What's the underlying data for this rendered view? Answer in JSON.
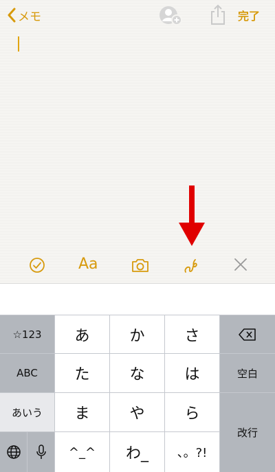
{
  "nav": {
    "back_label": "メモ",
    "done_label": "完了"
  },
  "toolbar": {
    "aa_label": "Aa"
  },
  "keyboard": {
    "row1": {
      "left": "☆123",
      "keys": [
        "あ",
        "か",
        "さ"
      ]
    },
    "row2": {
      "left": "ABC",
      "keys": [
        "た",
        "な",
        "は"
      ],
      "right": "空白"
    },
    "row3": {
      "left": "あいう",
      "keys": [
        "ま",
        "や",
        "ら"
      ]
    },
    "row4": {
      "keys": [
        "^_^",
        "わ_",
        "、。?!"
      ]
    },
    "return_label": "改行"
  },
  "colors": {
    "accent": "#d79a0c",
    "annotation": "#e00000"
  },
  "icons": [
    "chevron-left-icon",
    "add-person-icon",
    "share-icon",
    "checklist-icon",
    "camera-icon",
    "sketch-icon",
    "close-icon",
    "backspace-icon",
    "globe-icon",
    "microphone-icon",
    "arrow-down-icon"
  ]
}
